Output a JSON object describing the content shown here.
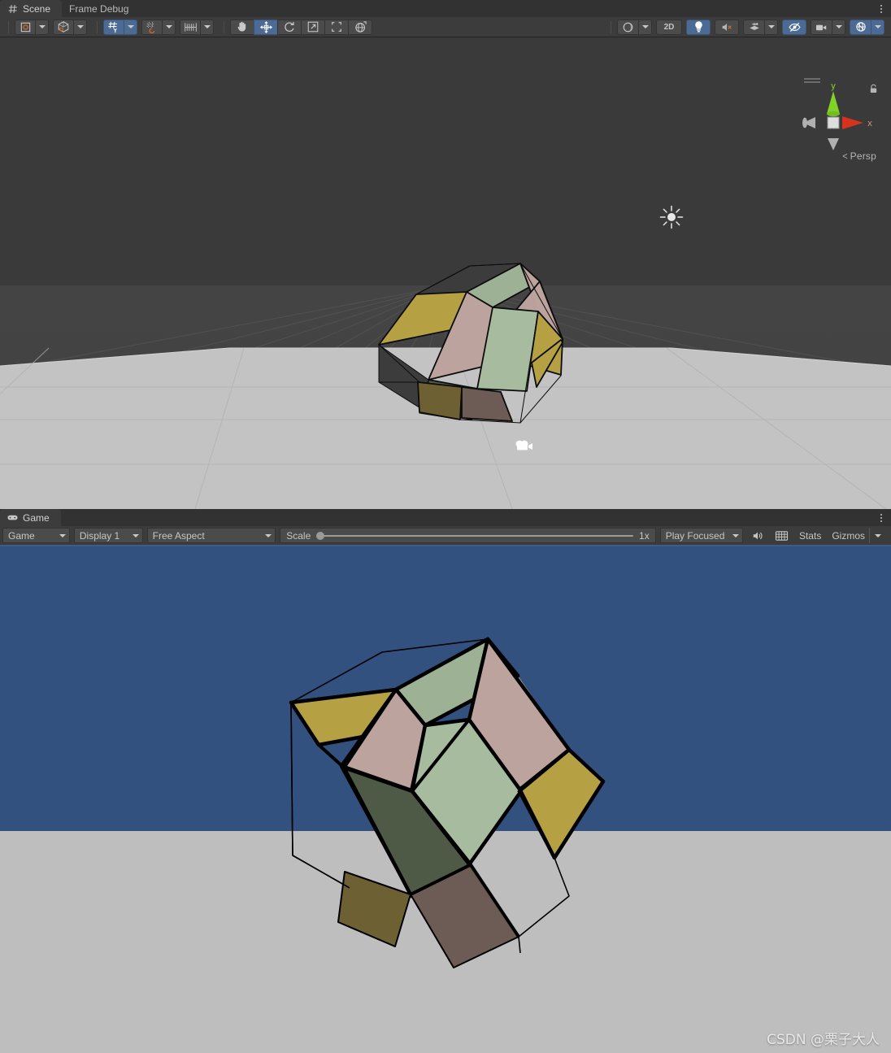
{
  "scene_panel": {
    "tabs": [
      {
        "label": "Scene",
        "icon": "grid-hash-icon",
        "active": true
      },
      {
        "label": "Frame Debug",
        "icon": "none",
        "active": false
      }
    ],
    "toolbar": {
      "groups": [
        {
          "name": "draw-mode",
          "buttons": [
            {
              "name": "shaded-draw-mode-button",
              "icon": "shaded-mode-icon",
              "active": false
            },
            {
              "name": "draw-mode-dropdown",
              "icon": "chevron-down-icon",
              "active": false
            }
          ]
        },
        {
          "name": "shading-mode",
          "buttons": [
            {
              "name": "shading-mode-button",
              "icon": "cube-wire-icon",
              "active": false
            },
            {
              "name": "shading-mode-dropdown",
              "icon": "chevron-down-icon",
              "active": false
            }
          ]
        },
        {
          "name": "grid-and-snap",
          "buttons": [
            {
              "name": "grid-visibility-button",
              "icon": "grid-axis-icon",
              "active": true
            },
            {
              "name": "grid-dropdown",
              "icon": "chevron-down-icon",
              "active": true
            },
            {
              "name": "grid-snapping-button",
              "icon": "grid-snap-icon",
              "active": false
            },
            {
              "name": "grid-snapping-dropdown",
              "icon": "chevron-down-icon",
              "active": false
            },
            {
              "name": "increment-snap-button",
              "icon": "ruler-icon",
              "active": false
            },
            {
              "name": "increment-snap-dropdown",
              "icon": "chevron-down-icon",
              "active": false
            }
          ]
        },
        {
          "name": "transform-tools",
          "buttons": [
            {
              "name": "hand-tool-button",
              "icon": "hand-icon",
              "active": false
            },
            {
              "name": "move-tool-button",
              "icon": "move-arrows-icon",
              "active": true
            },
            {
              "name": "rotate-tool-button",
              "icon": "rotate-icon",
              "active": false
            },
            {
              "name": "scale-tool-button",
              "icon": "scale-icon",
              "active": false
            },
            {
              "name": "rect-tool-button",
              "icon": "rect-transform-icon",
              "active": false
            },
            {
              "name": "transform-tool-button",
              "icon": "transform-globe-icon",
              "active": false
            }
          ]
        },
        {
          "name": "view-options",
          "buttons": [
            {
              "name": "scene-lighting-sphere-button",
              "icon": "sphere-shading-icon",
              "active": false
            },
            {
              "name": "scene-view-dropdown",
              "icon": "chevron-down-icon",
              "active": false
            },
            {
              "name": "toggle-2d-button",
              "icon": "none",
              "label": "2D",
              "active": false
            },
            {
              "name": "toggle-scene-lighting-button",
              "icon": "lightbulb-icon",
              "active": true
            },
            {
              "name": "toggle-audio-button",
              "icon": "audio-muted-icon",
              "active": false
            },
            {
              "name": "fx-effects-button",
              "icon": "effects-layers-icon",
              "active": false
            },
            {
              "name": "fx-effects-dropdown",
              "icon": "chevron-down-icon",
              "active": false
            },
            {
              "name": "scene-visibility-button",
              "icon": "eye-off-icon",
              "active": true
            },
            {
              "name": "camera-settings-button",
              "icon": "camera-icon",
              "active": false
            },
            {
              "name": "camera-settings-dropdown",
              "icon": "chevron-down-icon",
              "active": false
            },
            {
              "name": "gizmos-toggle-button",
              "icon": "gizmo-globe-icon",
              "active": true
            },
            {
              "name": "gizmos-dropdown",
              "icon": "chevron-down-icon",
              "active": true
            }
          ]
        }
      ],
      "labels": {
        "two_d": "2D"
      }
    },
    "gizmo": {
      "projection_label": "Persp",
      "axis_x_label": "x",
      "axis_y_label": "y",
      "axis_x_color": "#d6321e",
      "axis_y_color": "#7fd326",
      "axis_neutral_color": "#b0b0b0",
      "center_color": "#d8d8d8"
    },
    "overlays": {
      "directional_light_gizmo": "sun-icon",
      "camera_gizmo": "camera-icon"
    },
    "background": {
      "sky_color": "#3d3d3d",
      "grid_line_color": "#4e4e4e",
      "ground_plane_color": "#c2c2c2"
    }
  },
  "game_panel": {
    "tabs": [
      {
        "label": "Game",
        "icon": "gamepad-icon",
        "active": true
      }
    ],
    "toolbar": {
      "play_mode_target": "Game",
      "display": "Display 1",
      "aspect": "Free Aspect",
      "scale_label": "Scale",
      "scale_value": "1x",
      "scale_slider_percent": 0,
      "focus_mode": "Play Focused",
      "mute_audio_icon": "speaker-icon",
      "stats_toggle_icon": "grid-stats-icon",
      "stats_label": "Stats",
      "gizmos_label": "Gizmos",
      "gizmos_caret_icon": "chevron-down-icon"
    },
    "render": {
      "sky_color": "#32517f",
      "ground_color": "#bebebe"
    },
    "watermark": "CSDN @栗子大人"
  },
  "object": {
    "name": "rubik-cube-object",
    "description": "Beveled cube mesh with colored rhombic faces",
    "face_colors": {
      "sage_green": "#9db194",
      "dusty_pink": "#bda39d",
      "gold_olive": "#b5a044",
      "dark_olive_green": "#4e5a45",
      "dark_gold": "#6d6134",
      "dark_brown": "#6d5c55",
      "light_sage": "#a7bb9e",
      "edge_color": "#000000",
      "wire_color": "#1a1a1a"
    }
  }
}
